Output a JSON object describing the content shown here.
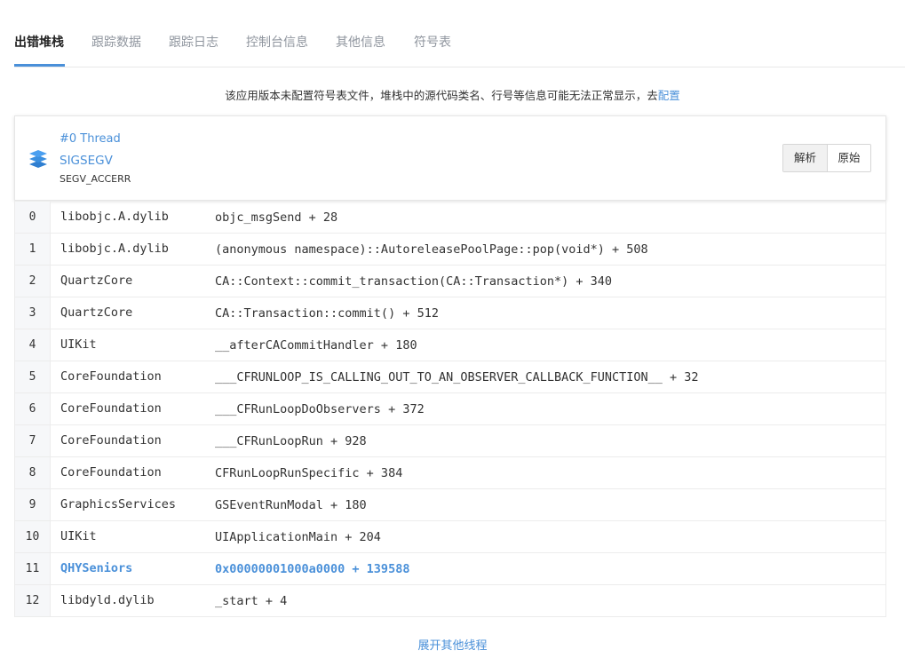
{
  "tabs": [
    {
      "label": "出错堆栈",
      "active": true
    },
    {
      "label": "跟踪数据",
      "active": false
    },
    {
      "label": "跟踪日志",
      "active": false
    },
    {
      "label": "控制台信息",
      "active": false
    },
    {
      "label": "其他信息",
      "active": false
    },
    {
      "label": "符号表",
      "active": false
    }
  ],
  "notice": {
    "text": "该应用版本未配置符号表文件，堆栈中的源代码类名、行号等信息可能无法正常显示，去",
    "link": "配置"
  },
  "thread": {
    "icon": "layers-icon",
    "name": "#0 Thread",
    "signal": "SIGSEGV",
    "code": "SEGV_ACCERR",
    "view_modes": [
      {
        "label": "解析",
        "active": true
      },
      {
        "label": "原始",
        "active": false
      }
    ]
  },
  "frames": [
    {
      "index": "0",
      "library": "libobjc.A.dylib",
      "symbol": "objc_msgSend + 28",
      "own": false
    },
    {
      "index": "1",
      "library": "libobjc.A.dylib",
      "symbol": "(anonymous namespace)::AutoreleasePoolPage::pop(void*) + 508",
      "own": false
    },
    {
      "index": "2",
      "library": "QuartzCore",
      "symbol": "CA::Context::commit_transaction(CA::Transaction*) + 340",
      "own": false
    },
    {
      "index": "3",
      "library": "QuartzCore",
      "symbol": "CA::Transaction::commit() + 512",
      "own": false
    },
    {
      "index": "4",
      "library": "UIKit",
      "symbol": "__afterCACommitHandler + 180",
      "own": false
    },
    {
      "index": "5",
      "library": "CoreFoundation",
      "symbol": "___CFRUNLOOP_IS_CALLING_OUT_TO_AN_OBSERVER_CALLBACK_FUNCTION__ + 32",
      "own": false
    },
    {
      "index": "6",
      "library": "CoreFoundation",
      "symbol": "___CFRunLoopDoObservers + 372",
      "own": false
    },
    {
      "index": "7",
      "library": "CoreFoundation",
      "symbol": "___CFRunLoopRun + 928",
      "own": false
    },
    {
      "index": "8",
      "library": "CoreFoundation",
      "symbol": "CFRunLoopRunSpecific + 384",
      "own": false
    },
    {
      "index": "9",
      "library": "GraphicsServices",
      "symbol": "GSEventRunModal + 180",
      "own": false
    },
    {
      "index": "10",
      "library": "UIKit",
      "symbol": "UIApplicationMain + 204",
      "own": false
    },
    {
      "index": "11",
      "library": "QHYSeniors",
      "symbol": "0x00000001000a0000 + 139588",
      "own": true
    },
    {
      "index": "12",
      "library": "libdyld.dylib",
      "symbol": "_start + 4",
      "own": false
    }
  ],
  "expand_label": "展开其他线程",
  "colors": {
    "accent": "#4a90d9",
    "text": "#333333",
    "muted": "#8f959e",
    "index_bg": "#f6f7f9"
  }
}
